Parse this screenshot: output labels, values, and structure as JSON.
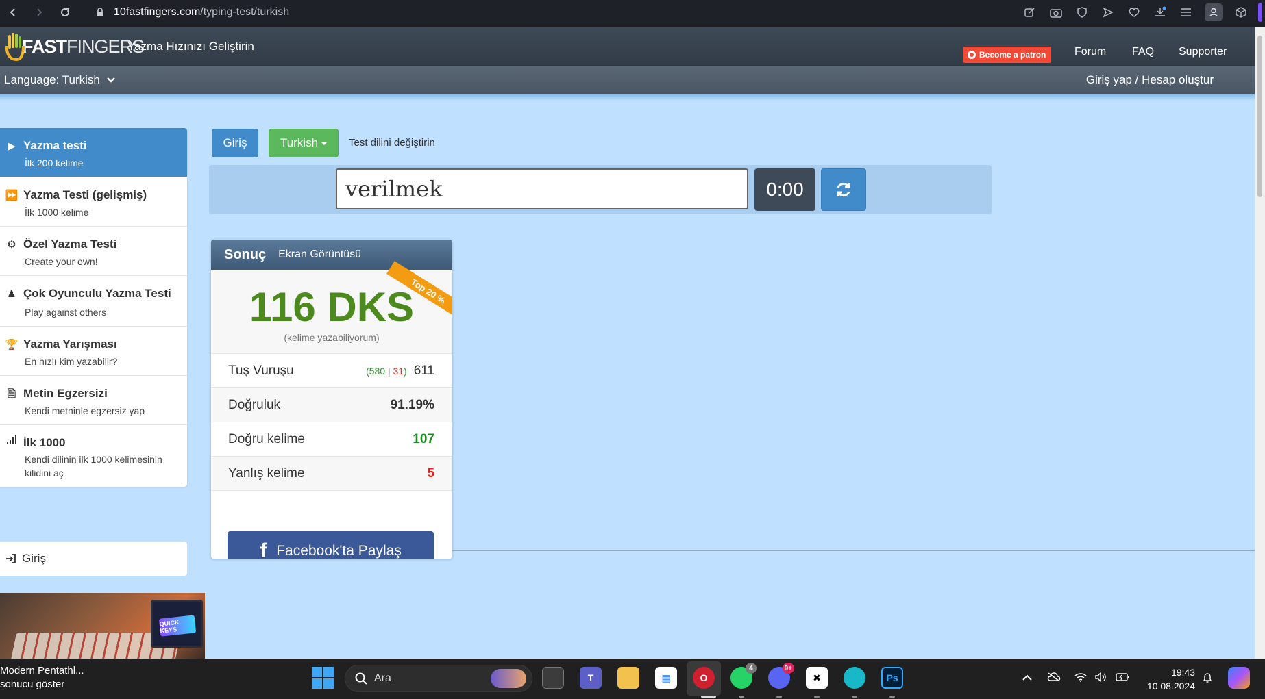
{
  "browser": {
    "url_host": "10fastfingers.com",
    "url_path": "/typing-test/turkish"
  },
  "site": {
    "logo_part1": "10",
    "logo_part2": "FAST",
    "logo_part3": "FINGERS",
    "slogan": "Yazma Hızınızı Geliştirin",
    "patron_button": "Become a patron",
    "nav": [
      "Forum",
      "FAQ",
      "Supporter"
    ],
    "language_label": "Language: Turkish",
    "login_link": "Giriş yap / Hesap oluştur"
  },
  "sidebar": {
    "items": [
      {
        "title": "Yazma testi",
        "sub": "İlk 200 kelime",
        "icon": "play-icon",
        "active": true
      },
      {
        "title": "Yazma Testi (gelişmiş)",
        "sub": "İlk 1000 kelime",
        "icon": "fast-forward-icon"
      },
      {
        "title": "Özel Yazma Testi",
        "sub": "Create your own!",
        "icon": "gears-icon"
      },
      {
        "title": "Çok Oyunculu Yazma Testi",
        "sub": "Play against others",
        "icon": "users-icon"
      },
      {
        "title": "Yazma Yarışması",
        "sub": "En hızlı kim yazabilir?",
        "icon": "trophy-icon"
      },
      {
        "title": "Metin Egzersizi",
        "sub": "Kendi metninle egzersiz yap",
        "icon": "document-icon"
      },
      {
        "title": "İlk 1000",
        "sub": "Kendi dilinin ilk 1000 kelimesinin kilidini aç",
        "icon": "signal-icon"
      }
    ],
    "login": "Giriş"
  },
  "ad": {
    "badge": "QUICK KEYS"
  },
  "toolbar": {
    "giris_button": "Giriş",
    "language_button": "Turkish",
    "language_hint": "Test dilini değiştirin"
  },
  "typing": {
    "input_value": "verilmek",
    "timer": "0:00"
  },
  "result": {
    "title": "Sonuç",
    "screenshot_tab": "Ekran Görüntüsü",
    "ribbon": "Top 20 %",
    "wpm": "116 DKS",
    "wpm_sub": "(kelime yazabiliyorum)",
    "keystrokes_label": "Tuş Vuruşu",
    "keystrokes_correct": "580",
    "keystrokes_wrong": "31",
    "keystrokes_total": "611",
    "accuracy_label": "Doğruluk",
    "accuracy_value": "91.19%",
    "correct_words_label": "Doğru kelime",
    "correct_words_value": "107",
    "wrong_words_label": "Yanlış kelime",
    "wrong_words_value": "5",
    "facebook_button": "Facebook'ta Paylaş"
  },
  "taskbar": {
    "app_title": "Modern Pentathl...",
    "app_sub": "sonucu göster",
    "search_placeholder": "Ara",
    "whatsapp_badge": "4",
    "discord_badge": "9+",
    "time": "19:43",
    "date": "10.08.2024"
  },
  "colors": {
    "accent_blue": "#428bca",
    "green_button": "#5cb85c",
    "wpm_green": "#4d8a1e",
    "page_background": "#bfe0ff"
  }
}
